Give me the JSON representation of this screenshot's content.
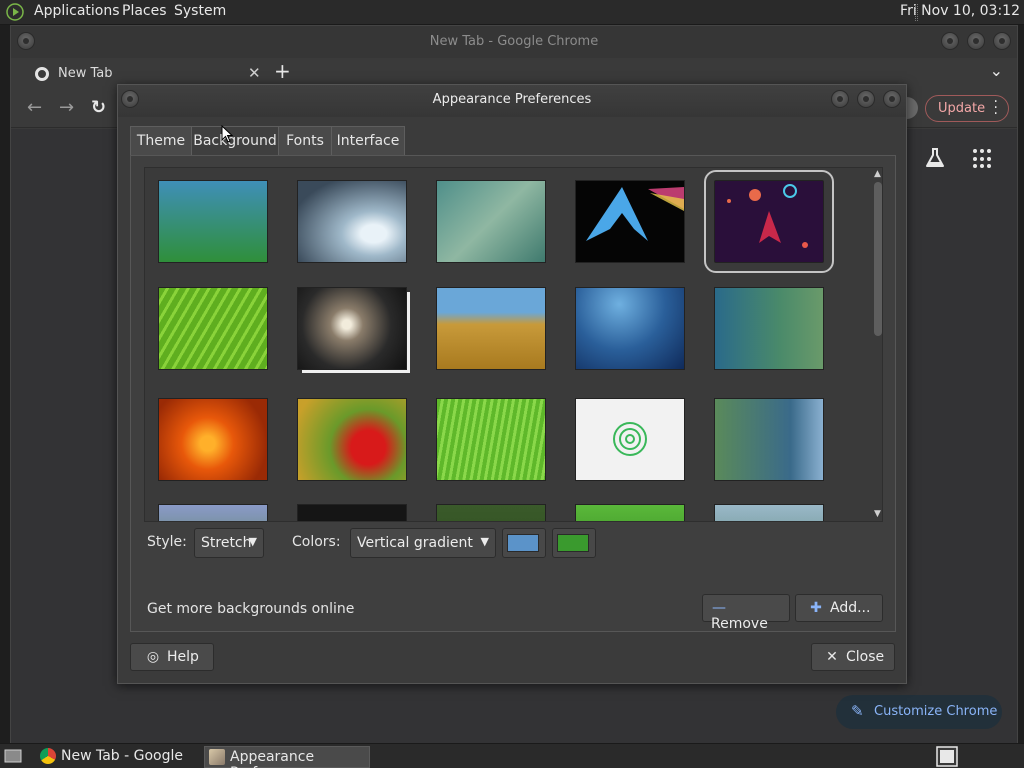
{
  "top_panel": {
    "menus": [
      "Applications",
      "Places",
      "System"
    ],
    "clock": "Fri Nov 10, 03:12"
  },
  "chrome": {
    "window_title": "New Tab - Google Chrome",
    "tab_label": "New Tab",
    "update_label": "Update",
    "customize_label": "Customize Chrome"
  },
  "dialog": {
    "title": "Appearance Preferences",
    "tabs": [
      "Theme",
      "Background",
      "Fonts",
      "Interface"
    ],
    "active_tab": "Background",
    "style_label": "Style:",
    "style_value": "Stretch",
    "colors_label": "Colors:",
    "colors_value": "Vertical gradient",
    "primary_color": "#5b93c9",
    "secondary_color": "#3a9a2e",
    "more_link": "Get more backgrounds online",
    "remove_label": "Remove",
    "add_label": "Add...",
    "help_label": "Help",
    "close_label": "Close",
    "wallpapers": [
      "blue-green-gradient",
      "water-drop",
      "soft-teal-gradient",
      "arch-prism",
      "space-rocket",
      "green-leaf",
      "spiral-galaxy",
      "wheat-grass",
      "blue-abstract",
      "teal-bokeh",
      "orange-flower",
      "red-flower",
      "green-grass",
      "spiral-logo",
      "teal-wave",
      "partial-1",
      "partial-2",
      "partial-3",
      "partial-4",
      "partial-5"
    ]
  },
  "taskbar": {
    "tasks": [
      "New Tab - Google ...",
      "Appearance Prefere..."
    ]
  }
}
